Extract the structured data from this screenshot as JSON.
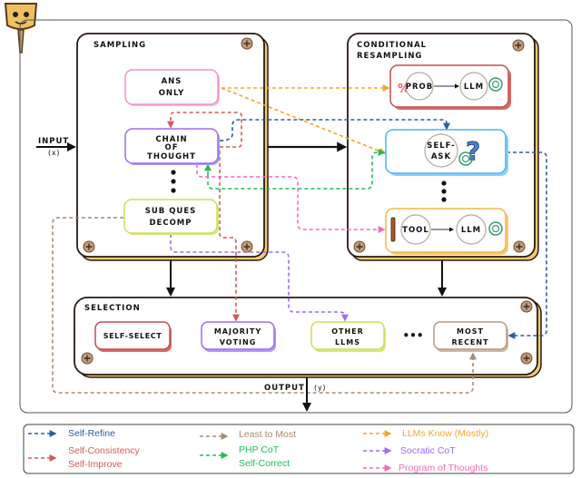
{
  "colors": {
    "self_refine": "#2a5e9e",
    "self_consistency": "#d35a5a",
    "least_to_most": "#a88b6e",
    "php_cot": "#1fbe5a",
    "llms_know": "#f5a623",
    "socratic": "#9b6cf5",
    "program_of_thoughts": "#f26ac0"
  },
  "io": {
    "input": "INPUT",
    "input_var": "(x)",
    "output": "OUTPUT",
    "output_var": "(y)"
  },
  "sampling": {
    "title": "SAMPLING",
    "ans_only": [
      "ANS",
      "ONLY"
    ],
    "cot": [
      "CHAIN",
      "OF",
      "THOUGHT"
    ],
    "subq": [
      "SUB QUES",
      "DECOMP"
    ]
  },
  "resampling": {
    "title": [
      "CONDITIONAL",
      "RESAMPLING"
    ],
    "prob": "PROB",
    "llm": "LLM",
    "self_ask": [
      "SELF-",
      "ASK"
    ],
    "tool": "TOOL",
    "percent": "%",
    "question": "?"
  },
  "selection": {
    "title": "SELECTION",
    "self_select": "SELF-SELECT",
    "majority": [
      "MAJORITY",
      "VOTING"
    ],
    "other": [
      "OTHER",
      "LLMS"
    ],
    "most_recent": [
      "MOST",
      "RECENT"
    ],
    "ellipsis": "•••"
  },
  "legend": {
    "self_refine": "Self-Refine",
    "self_consistency": "Self-Consistency",
    "self_improve": "Self-Improve",
    "least_to_most": "Least to Most",
    "php_cot": "PHP CoT",
    "self_correct": "Self-Correct",
    "llms_know": "LLMs Know (Mostly)",
    "socratic": "Socratic CoT",
    "pot": "Program of Thoughts"
  }
}
